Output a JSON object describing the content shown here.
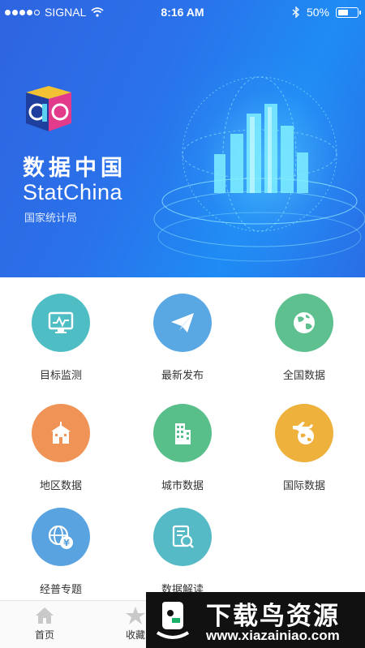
{
  "status_bar": {
    "carrier": "SIGNAL",
    "time": "8:16 AM",
    "battery": "50%",
    "battery_level": 0.5,
    "signal_dots_filled": 4,
    "signal_dots_total": 5
  },
  "hero": {
    "title": "数据中国",
    "subtitle": "StatChina",
    "organization": "国家统计局"
  },
  "menu": [
    {
      "label": "目标监测",
      "icon": "monitor-chart-icon",
      "color": "#4fbdc4"
    },
    {
      "label": "最新发布",
      "icon": "paper-plane-icon",
      "color": "#5aa8e3"
    },
    {
      "label": "全国数据",
      "icon": "globe-icon",
      "color": "#5dc08e"
    },
    {
      "label": "地区数据",
      "icon": "building-icon",
      "color": "#ef9456"
    },
    {
      "label": "城市数据",
      "icon": "city-icon",
      "color": "#58bf8a"
    },
    {
      "label": "国际数据",
      "icon": "plane-globe-icon",
      "color": "#edb13c"
    },
    {
      "label": "经普专题",
      "icon": "globe-yen-icon",
      "color": "#5aa3e1"
    },
    {
      "label": "数据解读",
      "icon": "document-search-icon",
      "color": "#55bac6"
    }
  ],
  "tabbar": [
    {
      "label": "首页",
      "icon": "home-icon"
    },
    {
      "label": "收藏",
      "icon": "star-icon"
    }
  ],
  "watermark": {
    "title": "下载鸟资源",
    "url": "www.xiazainiao.com"
  }
}
